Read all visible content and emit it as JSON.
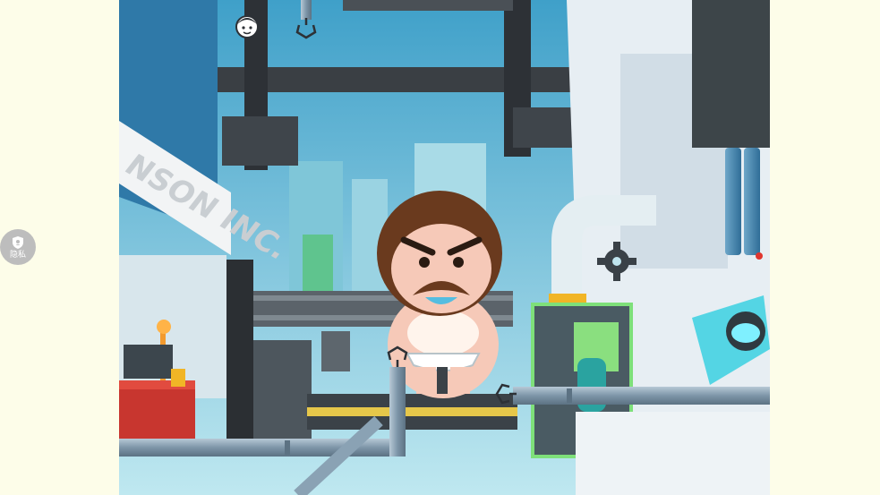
{
  "sidebar": {
    "privacy_label": "隐私",
    "privacy_icon": "shield-icon"
  },
  "scene": {
    "building_sign": "NSON INC.",
    "character": "angry-bearded-man-in-underwear",
    "hint_icon": "face-hint-icon",
    "hooks": [
      "top-hook",
      "left-hook",
      "right-hook"
    ]
  },
  "colors": {
    "page_bg": "#fdfde9",
    "sky": "#bfe4ee",
    "pipe": "#8aa2b4",
    "skin": "#f6c9b8",
    "hair": "#6a3a1e"
  }
}
